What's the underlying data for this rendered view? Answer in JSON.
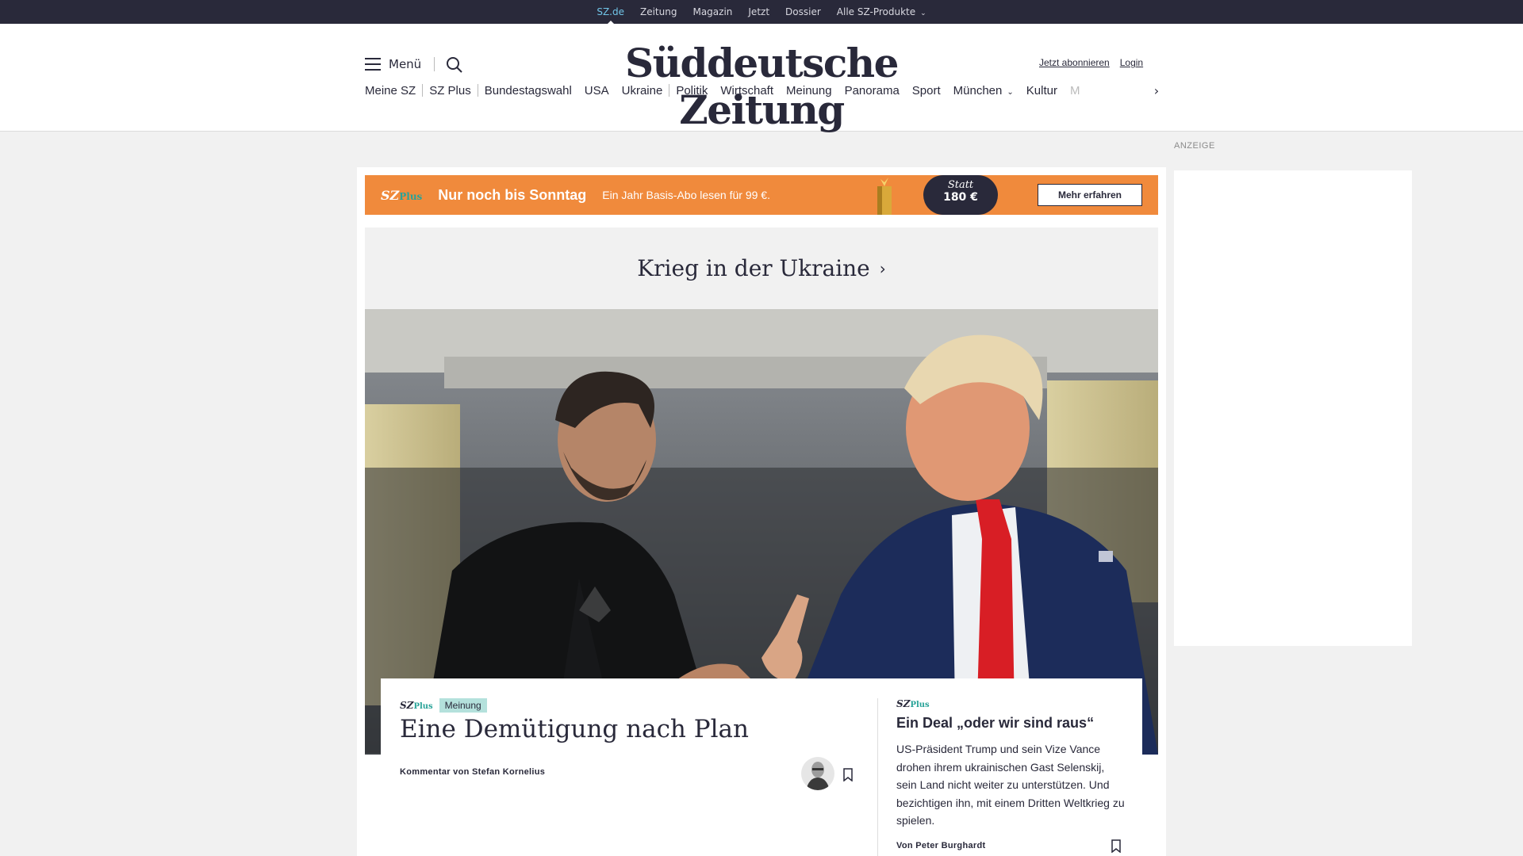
{
  "topbar": {
    "items": [
      "SZ.de",
      "Zeitung",
      "Magazin",
      "Jetzt",
      "Dossier",
      "Alle SZ-Produkte"
    ]
  },
  "header": {
    "menu_label": "Menü",
    "logo": "Süddeutsche Zeitung",
    "subscribe": "Jetzt abonnieren",
    "login": "Login"
  },
  "nav": {
    "items": [
      "Meine SZ",
      "SZ Plus",
      "Bundestagswahl",
      "USA",
      "Ukraine",
      "Politik",
      "Wirtschaft",
      "Meinung",
      "Panorama",
      "Sport",
      "München",
      "Kultur",
      "M"
    ]
  },
  "promo": {
    "brand": "SZ",
    "brand_plus": "Plus",
    "headline": "Nur noch bis Sonntag",
    "subline": "Ein Jahr Basis-Abo lesen für 99 €.",
    "statt": "Statt",
    "old_price": "180 €",
    "cta": "Mehr erfahren",
    "color": "#f08a3c"
  },
  "topic": {
    "title": "Krieg in der Ukraine"
  },
  "lead": {
    "brand": "SZ",
    "brand_plus": "Plus",
    "category": "Meinung",
    "title": "Eine Demütigung nach Plan",
    "byline": "Kommentar von Stefan Kornelius"
  },
  "side": {
    "brand": "SZ",
    "brand_plus": "Plus",
    "title": "Ein Deal „oder wir sind raus“",
    "text": "US-Präsident Trump und sein Vize Vance drohen ihrem ukrainischen Gast Selenskij, sein Land nicht weiter zu unterstützen. Und bezichtigen ihn, mit einem Dritten Weltkrieg zu spielen.",
    "byline": "Von Peter Burghardt"
  },
  "ad": {
    "label": "ANZEIGE"
  },
  "colors": {
    "dark": "#29293a",
    "accent_blue": "#71c5e8",
    "plus_green": "#29a398",
    "badge": "#b4e1dc"
  }
}
